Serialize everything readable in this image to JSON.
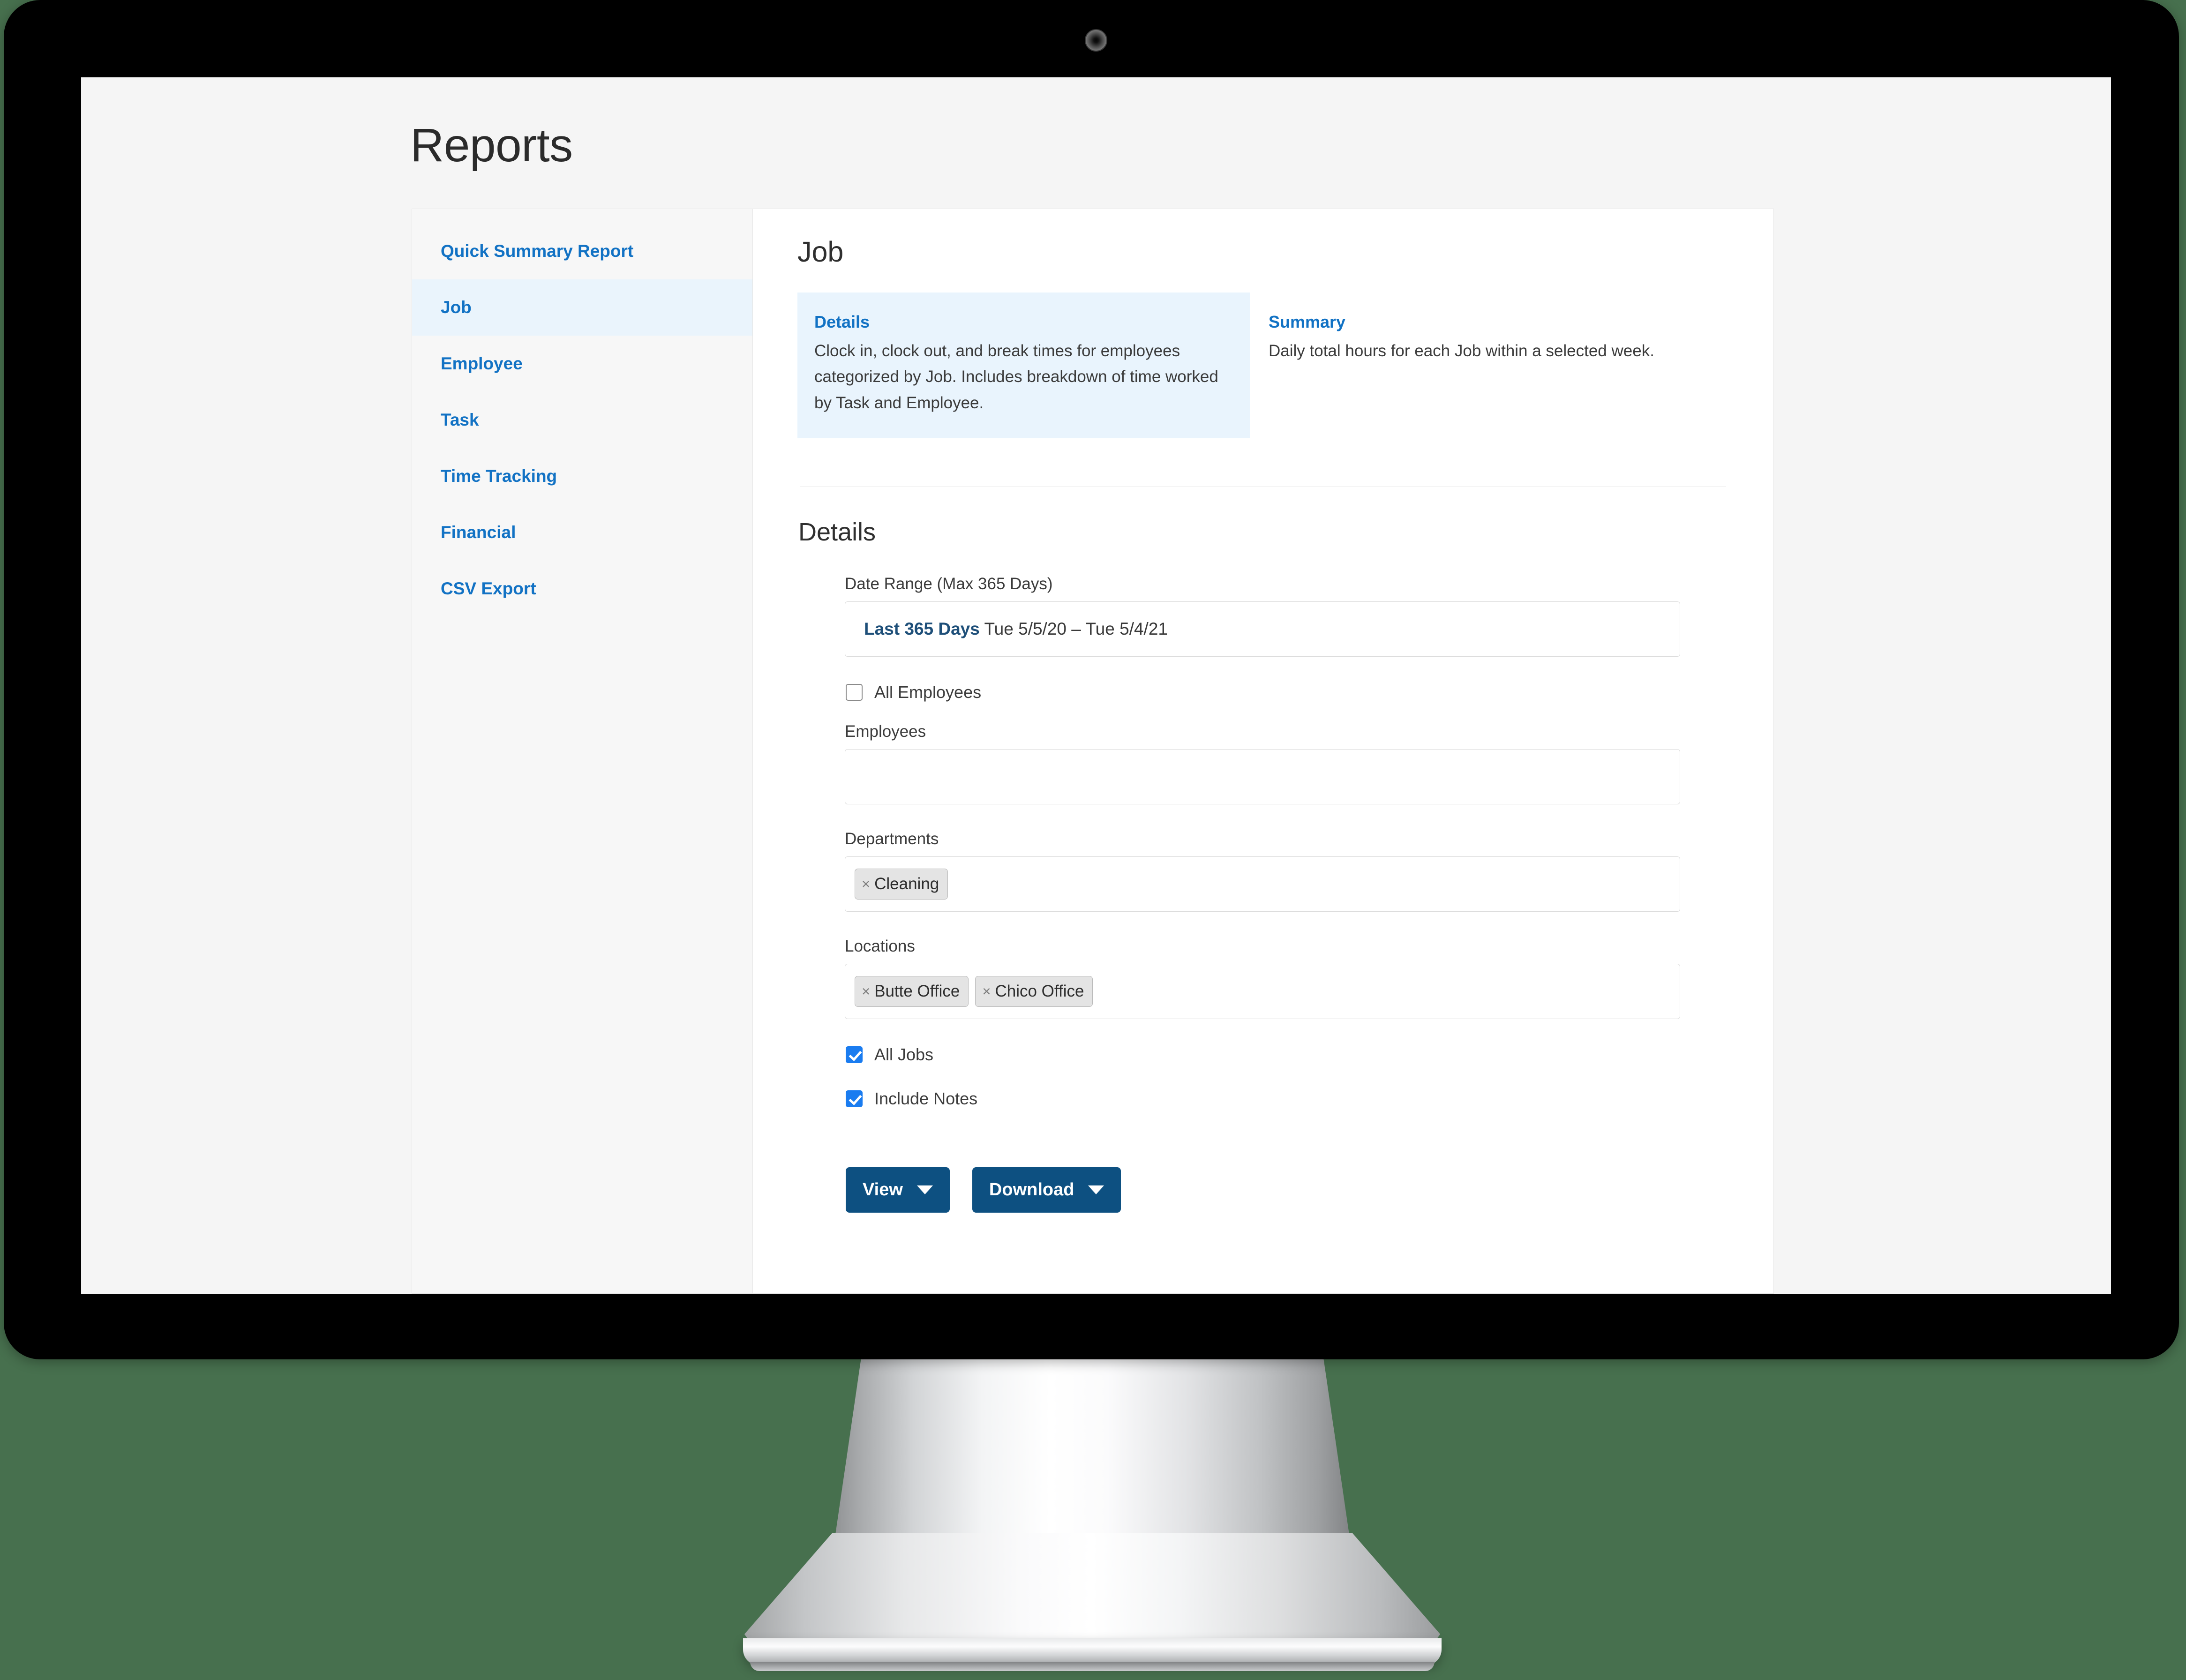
{
  "page": {
    "title": "Reports",
    "background_color": "#47704e",
    "accent_color": "#1272c4",
    "button_color": "#0d5081"
  },
  "sidebar": {
    "items": [
      {
        "label": "Quick Summary Report",
        "active": false
      },
      {
        "label": "Job",
        "active": true
      },
      {
        "label": "Employee",
        "active": false
      },
      {
        "label": "Task",
        "active": false
      },
      {
        "label": "Time Tracking",
        "active": false
      },
      {
        "label": "Financial",
        "active": false
      },
      {
        "label": "CSV Export",
        "active": false
      }
    ]
  },
  "main": {
    "heading": "Job",
    "report_types": [
      {
        "title": "Details",
        "description": "Clock in, clock out, and break times for employees categorized by Job. Includes breakdown of time worked by Task and Employee.",
        "selected": true
      },
      {
        "title": "Summary",
        "description": "Daily total hours for each Job within a selected week.",
        "selected": false
      }
    ],
    "section_title": "Details",
    "form": {
      "date_range": {
        "label": "Date Range (Max 365 Days)",
        "preset": "Last 365 Days",
        "range": "Tue 5/5/20 – Tue 5/4/21"
      },
      "all_employees": {
        "label": "All Employees",
        "checked": false
      },
      "employees": {
        "label": "Employees",
        "value": "",
        "placeholder": ""
      },
      "departments": {
        "label": "Departments",
        "tags": [
          "Cleaning"
        ],
        "remove_glyph": "×"
      },
      "locations": {
        "label": "Locations",
        "tags": [
          "Butte Office",
          "Chico Office"
        ],
        "remove_glyph": "×"
      },
      "all_jobs": {
        "label": "All Jobs",
        "checked": true
      },
      "include_notes": {
        "label": "Include Notes",
        "checked": true
      }
    },
    "actions": {
      "view_label": "View",
      "download_label": "Download"
    }
  }
}
